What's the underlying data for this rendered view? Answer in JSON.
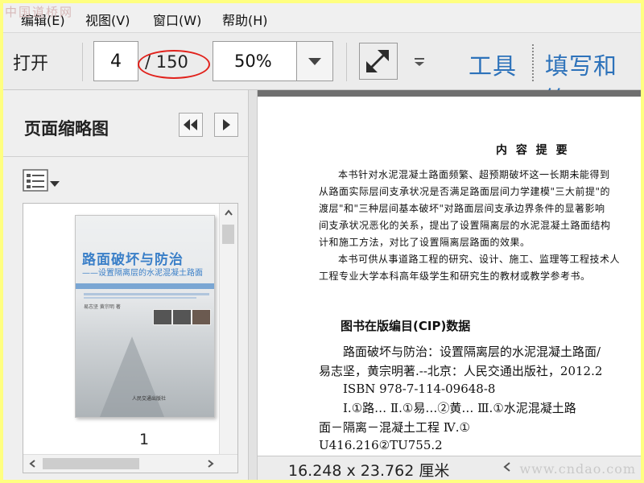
{
  "watermark": {
    "top": "中国道桥网",
    "bottom": "www.cndao.com"
  },
  "menubar": {
    "items": [
      "编辑(E)",
      "视图(V)",
      "窗口(W)",
      "帮助(H)"
    ]
  },
  "toolbar": {
    "open_label": "打开",
    "page_current": "4",
    "page_total": "/ 150",
    "zoom": "50%",
    "tools_label": "工具",
    "fill_sign_label": "填写和签"
  },
  "thumbnails_panel": {
    "title": "页面缩略图",
    "page_label": "1",
    "cover": {
      "title": "路面破坏与防治",
      "subtitle": "——设置隔离层的水泥混凝土路面",
      "authors": "易志坚  黄宗明  著",
      "publisher": "人民交通出版社"
    }
  },
  "document": {
    "heading": "内 容 提 要",
    "summary_lines": [
      "本书针对水泥混凝土路面频繁、超预期破坏这一长期未能得到",
      "从路面实际层间支承状况是否满足路面层间力学建模\"三大前提\"的",
      "渡层\"和\"三种层间基本破坏\"对路面层间支承边界条件的显著影响",
      "间支承状况恶化的关系，提出了设置隔离层的水泥混凝土路面结构",
      "计和施工方法，对比了设置隔离层路面的效果。",
      "本书可供从事道路工程的研究、设计、施工、监理等工程技术人",
      "工程专业大学本科高年级学生和研究生的教材或教学参考书。"
    ],
    "cip_title": "图书在版编目(CIP)数据",
    "cip_lines": [
      "路面破坏与防治：设置隔离层的水泥混凝土路面/",
      "易志坚，黄宗明著.--北京：人民交通出版社，2012.2",
      "ISBN  978-7-114-09648-8",
      "Ⅰ.①路…  Ⅱ.①易…②黄…  Ⅲ.①水泥混凝土路",
      "面－隔离－混凝土工程  Ⅳ.①",
      "U416.216②TU755.2"
    ]
  },
  "statusbar": {
    "page_size": "16.248 x 23.762 厘米"
  },
  "colors": {
    "link_blue": "#2d72ba",
    "highlight_oval": "#e1221c",
    "outer_border": "#ffff80"
  }
}
